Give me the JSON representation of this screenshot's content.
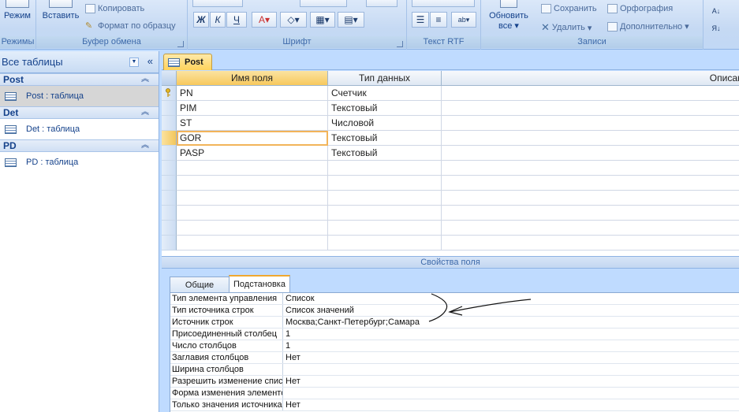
{
  "ribbon": {
    "modes": {
      "button": "Режим",
      "group": "Режимы"
    },
    "clipboard": {
      "paste": "Вставить",
      "copy": "Копировать",
      "format_painter": "Формат по образцу",
      "group": "Буфер обмена"
    },
    "font": {
      "bold": "Ж",
      "italic": "К",
      "group": "Шрифт"
    },
    "rtf": {
      "group": "Текст RTF"
    },
    "records": {
      "refresh": "Обновить",
      "refresh_sub": "все",
      "save": "Сохранить",
      "delete": "Удалить",
      "spelling": "Орфография",
      "more": "Дополнительно",
      "group": "Записи"
    }
  },
  "nav": {
    "header": "Все таблицы",
    "groups": [
      {
        "name": "Post",
        "item": "Post : таблица"
      },
      {
        "name": "Det",
        "item": "Det : таблица"
      },
      {
        "name": "PD",
        "item": "PD : таблица"
      }
    ]
  },
  "doc_tab": {
    "label": "Post"
  },
  "grid": {
    "headers": {
      "field": "Имя поля",
      "type": "Тип данных",
      "desc": "Описание"
    },
    "rows": [
      {
        "field": "PN",
        "type": "Счетчик"
      },
      {
        "field": "PIM",
        "type": "Текстовый"
      },
      {
        "field": "ST",
        "type": "Числовой"
      },
      {
        "field": "GOR",
        "type": "Текстовый"
      },
      {
        "field": "PASP",
        "type": "Текстовый"
      }
    ]
  },
  "props": {
    "title": "Свойства поля",
    "tabs": [
      "Общие",
      "Подстановка"
    ],
    "rows": [
      {
        "label": "Тип элемента управления",
        "value": "Список"
      },
      {
        "label": "Тип источника строк",
        "value": "Список значений"
      },
      {
        "label": "Источник строк",
        "value": "Москва;Санкт-Петербург;Самара"
      },
      {
        "label": "Присоединенный столбец",
        "value": "1"
      },
      {
        "label": "Число столбцов",
        "value": "1"
      },
      {
        "label": "Заглавия столбцов",
        "value": "Нет"
      },
      {
        "label": "Ширина столбцов",
        "value": ""
      },
      {
        "label": "Разрешить изменение списка",
        "value": "Нет"
      },
      {
        "label": "Форма изменения элементов списка",
        "value": ""
      },
      {
        "label": "Только значения источника строк",
        "value": "Нет"
      }
    ]
  },
  "colors": {
    "accent": "#f2b45a",
    "ribbon_bg": "#c5d9f3",
    "text": "#15428b"
  }
}
